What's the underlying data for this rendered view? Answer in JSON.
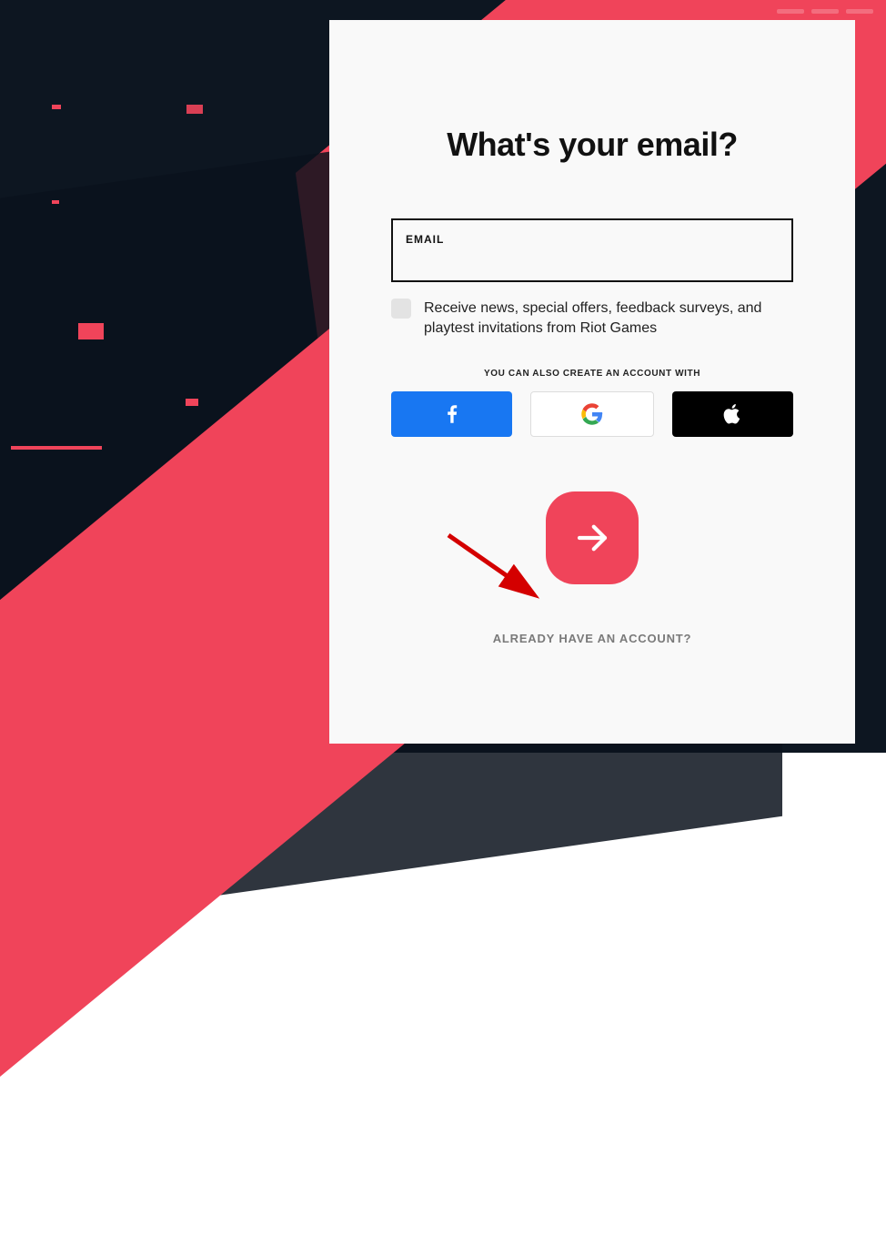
{
  "title": "What's your email?",
  "email": {
    "label": "EMAIL",
    "value": ""
  },
  "newsletter": {
    "label": "Receive news, special offers, feedback surveys, and playtest invitations from Riot Games"
  },
  "alt_label": "YOU CAN ALSO CREATE AN ACCOUNT WITH",
  "social": {
    "facebook": "Facebook",
    "google": "Google",
    "apple": "Apple"
  },
  "already": "ALREADY HAVE AN ACCOUNT?",
  "progress_steps": 3,
  "colors": {
    "accent": "#f0445a",
    "facebook": "#1877f2",
    "apple": "#000000",
    "bg_dark": "#0d1621"
  }
}
